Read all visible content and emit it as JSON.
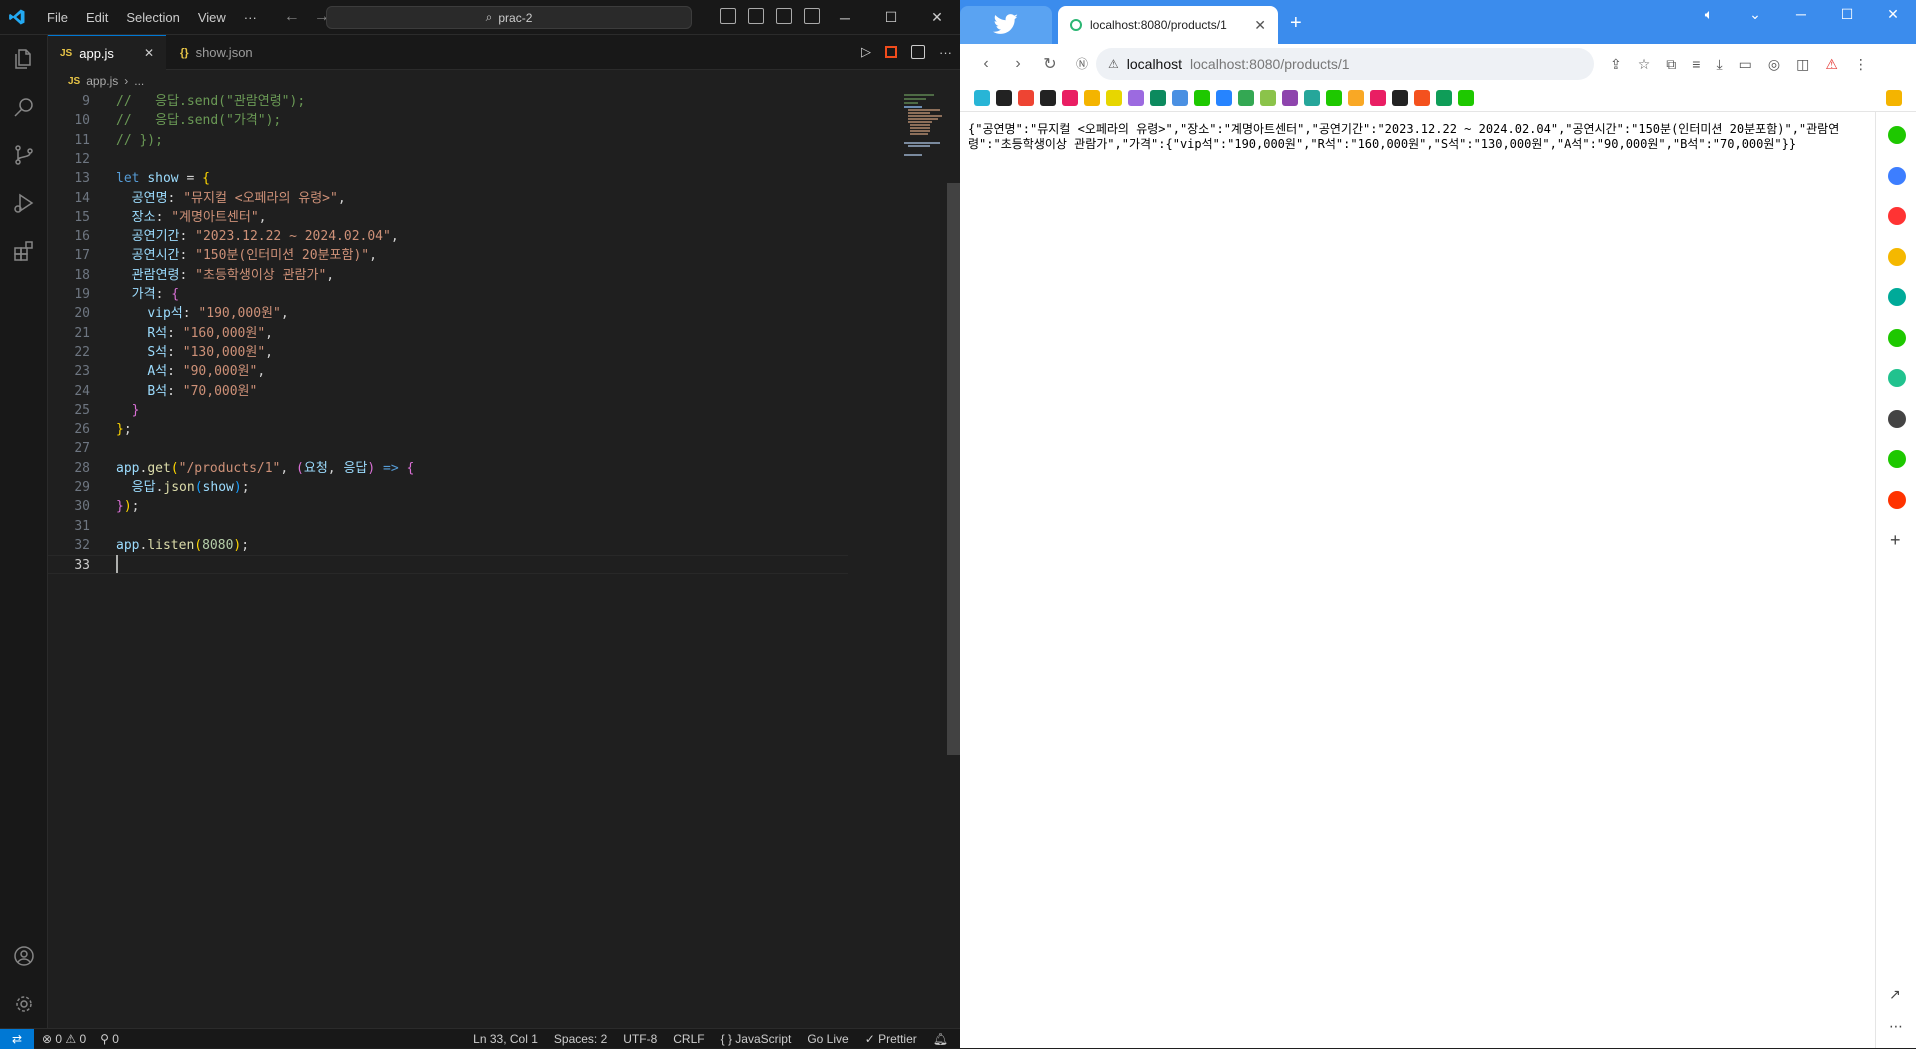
{
  "vscode": {
    "menu": [
      "File",
      "Edit",
      "Selection",
      "View",
      "···"
    ],
    "command_center": "prac-2",
    "tabs": [
      {
        "badge": "JS",
        "label": "app.js",
        "close": "✕"
      },
      {
        "badge": "{}",
        "label": "show.json"
      }
    ],
    "breadcrumb": {
      "file": "app.js",
      "rest": "..."
    },
    "code_lines": [
      {
        "n": "9",
        "parts": [
          [
            "c-com",
            "//   응답.send(\"관람연령\");"
          ]
        ]
      },
      {
        "n": "10",
        "parts": [
          [
            "c-com",
            "//   응답.send(\"가격\");"
          ]
        ]
      },
      {
        "n": "11",
        "parts": [
          [
            "c-com",
            "// });"
          ]
        ]
      },
      {
        "n": "12",
        "parts": []
      },
      {
        "n": "13",
        "parts": [
          [
            "c-kw",
            "let "
          ],
          [
            "c-var",
            "show"
          ],
          [
            "c-pun",
            " = "
          ],
          [
            "c-br1",
            "{"
          ]
        ]
      },
      {
        "n": "14",
        "parts": [
          [
            "c-pun",
            "  "
          ],
          [
            "c-var",
            "공연명"
          ],
          [
            "c-pun",
            ": "
          ],
          [
            "c-str",
            "\"뮤지컬 <오페라의 유령>\""
          ],
          [
            "c-pun",
            ","
          ]
        ]
      },
      {
        "n": "15",
        "parts": [
          [
            "c-pun",
            "  "
          ],
          [
            "c-var",
            "장소"
          ],
          [
            "c-pun",
            ": "
          ],
          [
            "c-str",
            "\"계명아트센터\""
          ],
          [
            "c-pun",
            ","
          ]
        ]
      },
      {
        "n": "16",
        "parts": [
          [
            "c-pun",
            "  "
          ],
          [
            "c-var",
            "공연기간"
          ],
          [
            "c-pun",
            ": "
          ],
          [
            "c-str",
            "\"2023.12.22 ~ 2024.02.04\""
          ],
          [
            "c-pun",
            ","
          ]
        ]
      },
      {
        "n": "17",
        "parts": [
          [
            "c-pun",
            "  "
          ],
          [
            "c-var",
            "공연시간"
          ],
          [
            "c-pun",
            ": "
          ],
          [
            "c-str",
            "\"150분(인터미션 20분포함)\""
          ],
          [
            "c-pun",
            ","
          ]
        ]
      },
      {
        "n": "18",
        "parts": [
          [
            "c-pun",
            "  "
          ],
          [
            "c-var",
            "관람연령"
          ],
          [
            "c-pun",
            ": "
          ],
          [
            "c-str",
            "\"초등학생이상 관람가\""
          ],
          [
            "c-pun",
            ","
          ]
        ]
      },
      {
        "n": "19",
        "parts": [
          [
            "c-pun",
            "  "
          ],
          [
            "c-var",
            "가격"
          ],
          [
            "c-pun",
            ": "
          ],
          [
            "c-br2",
            "{"
          ]
        ]
      },
      {
        "n": "20",
        "parts": [
          [
            "c-pun",
            "    "
          ],
          [
            "c-var",
            "vip석"
          ],
          [
            "c-pun",
            ": "
          ],
          [
            "c-str",
            "\"190,000원\""
          ],
          [
            "c-pun",
            ","
          ]
        ]
      },
      {
        "n": "21",
        "parts": [
          [
            "c-pun",
            "    "
          ],
          [
            "c-var",
            "R석"
          ],
          [
            "c-pun",
            ": "
          ],
          [
            "c-str",
            "\"160,000원\""
          ],
          [
            "c-pun",
            ","
          ]
        ]
      },
      {
        "n": "22",
        "parts": [
          [
            "c-pun",
            "    "
          ],
          [
            "c-var",
            "S석"
          ],
          [
            "c-pun",
            ": "
          ],
          [
            "c-str",
            "\"130,000원\""
          ],
          [
            "c-pun",
            ","
          ]
        ]
      },
      {
        "n": "23",
        "parts": [
          [
            "c-pun",
            "    "
          ],
          [
            "c-var",
            "A석"
          ],
          [
            "c-pun",
            ": "
          ],
          [
            "c-str",
            "\"90,000원\""
          ],
          [
            "c-pun",
            ","
          ]
        ]
      },
      {
        "n": "24",
        "parts": [
          [
            "c-pun",
            "    "
          ],
          [
            "c-var",
            "B석"
          ],
          [
            "c-pun",
            ": "
          ],
          [
            "c-str",
            "\"70,000원\""
          ]
        ]
      },
      {
        "n": "25",
        "parts": [
          [
            "c-pun",
            "  "
          ],
          [
            "c-br2",
            "}"
          ]
        ]
      },
      {
        "n": "26",
        "parts": [
          [
            "c-br1",
            "}"
          ],
          [
            "c-pun",
            ";"
          ]
        ]
      },
      {
        "n": "27",
        "parts": []
      },
      {
        "n": "28",
        "parts": [
          [
            "c-var",
            "app"
          ],
          [
            "c-pun",
            "."
          ],
          [
            "c-fn",
            "get"
          ],
          [
            "c-br1",
            "("
          ],
          [
            "c-str",
            "\"/products/1\""
          ],
          [
            "c-pun",
            ", "
          ],
          [
            "c-br2",
            "("
          ],
          [
            "c-var",
            "요청"
          ],
          [
            "c-pun",
            ", "
          ],
          [
            "c-var",
            "응답"
          ],
          [
            "c-br2",
            ")"
          ],
          [
            "c-kw",
            " => "
          ],
          [
            "c-br2",
            "{"
          ]
        ]
      },
      {
        "n": "29",
        "parts": [
          [
            "c-pun",
            "  "
          ],
          [
            "c-var",
            "응답"
          ],
          [
            "c-pun",
            "."
          ],
          [
            "c-fn",
            "json"
          ],
          [
            "c-br3",
            "("
          ],
          [
            "c-var",
            "show"
          ],
          [
            "c-br3",
            ")"
          ],
          [
            "c-pun",
            ";"
          ]
        ]
      },
      {
        "n": "30",
        "parts": [
          [
            "c-br2",
            "}"
          ],
          [
            "c-br1",
            ")"
          ],
          [
            "c-pun",
            ";"
          ]
        ]
      },
      {
        "n": "31",
        "parts": []
      },
      {
        "n": "32",
        "parts": [
          [
            "c-var",
            "app"
          ],
          [
            "c-pun",
            "."
          ],
          [
            "c-fn",
            "listen"
          ],
          [
            "c-br1",
            "("
          ],
          [
            "c-num",
            "8080"
          ],
          [
            "c-br1",
            ")"
          ],
          [
            "c-pun",
            ";"
          ]
        ]
      },
      {
        "n": "33",
        "parts": []
      }
    ],
    "status": {
      "errors": "⊗ 0 ⚠ 0",
      "ports": "⚲ 0",
      "position": "Ln 33, Col 1",
      "spaces": "Spaces: 2",
      "encoding": "UTF-8",
      "eol": "CRLF",
      "language": "{ } JavaScript",
      "golive": "Go Live",
      "prettier": "✓ Prettier"
    }
  },
  "browser": {
    "tab_title": "localhost:8080/products/1",
    "address_host": "localhost",
    "address_url": "localhost:8080/products/1",
    "page_text": "{\"공연명\":\"뮤지컬 <오페라의 유령>\",\"장소\":\"계명아트센터\",\"공연기간\":\"2023.12.22 ~ 2024.02.04\",\"공연시간\":\"150분(인터미션 20분포함)\",\"관람연령\":\"초등학생이상 관람가\",\"가격\":{\"vip석\":\"190,000원\",\"R석\":\"160,000원\",\"S석\":\"130,000원\",\"A석\":\"90,000원\",\"B석\":\"70,000원\"}}",
    "bookmark_colors": [
      "#28b5d6",
      "#222",
      "#e43",
      "#222",
      "#e91e63",
      "#f4b400",
      "#e7d600",
      "#9c6ae0",
      "#0c8a5e",
      "#4a90e2",
      "#1ec800",
      "#2684ff",
      "#34a853",
      "#8bc34a",
      "#8e44ad",
      "#26a69a",
      "#1ec800",
      "#f9a825",
      "#e91e63",
      "#222",
      "#f4511e",
      "#0f9d58",
      "#1ec800"
    ],
    "side_icon_colors": [
      "#1ec800",
      "#3d7eff",
      "#f33",
      "#f5b800",
      "#0a9",
      "#1ec800",
      "#21c28e",
      "#444",
      "#1ec800",
      "#f30"
    ]
  }
}
